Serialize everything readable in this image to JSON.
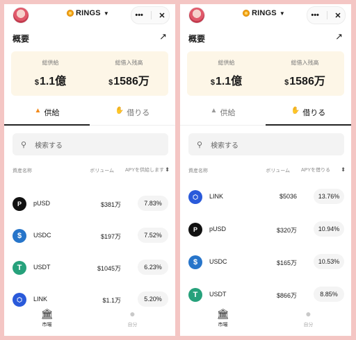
{
  "screens": [
    {
      "header": {
        "brand": "RINGS",
        "menu_icon": "•••",
        "close_icon": "✕"
      },
      "overview": {
        "title": "概要",
        "arrow": "↗"
      },
      "summary": {
        "supply_label": "総供給",
        "supply_currency": "$",
        "supply_value": "1.1億",
        "borrow_label": "総借入残高",
        "borrow_currency": "$",
        "borrow_value": "1586万"
      },
      "tabs": [
        {
          "label": "供給",
          "active": true
        },
        {
          "label": "借りる",
          "active": false
        }
      ],
      "search": {
        "placeholder": "検索する"
      },
      "columns": {
        "asset": "資産名称",
        "volume": "ボリューム",
        "apy": "APYを供給します"
      },
      "rows": [
        {
          "asset": "pUSD",
          "icon": "pusd-icon",
          "volume": "$381万",
          "apy": "7.83%"
        },
        {
          "asset": "USDC",
          "icon": "usdc-icon",
          "volume": "$197万",
          "apy": "7.52%"
        },
        {
          "asset": "USDT",
          "icon": "usdt-icon",
          "volume": "$1045万",
          "apy": "6.23%"
        },
        {
          "asset": "LINK",
          "icon": "link-icon",
          "volume": "$1.1万",
          "apy": "5.20%"
        }
      ],
      "nav": {
        "market": "市場",
        "me": "自分"
      }
    },
    {
      "header": {
        "brand": "RINGS",
        "menu_icon": "•••",
        "close_icon": "✕"
      },
      "overview": {
        "title": "概要",
        "arrow": "↗"
      },
      "summary": {
        "supply_label": "総供給",
        "supply_currency": "$",
        "supply_value": "1.1億",
        "borrow_label": "総借入残高",
        "borrow_currency": "$",
        "borrow_value": "1586万"
      },
      "tabs": [
        {
          "label": "供給",
          "active": false
        },
        {
          "label": "借りる",
          "active": true
        }
      ],
      "search": {
        "placeholder": "検索する"
      },
      "columns": {
        "asset": "資産名称",
        "volume": "ボリューム",
        "apy": "APYを借りる"
      },
      "rows": [
        {
          "asset": "LINK",
          "icon": "link-icon",
          "volume": "$5036",
          "apy": "13.76%"
        },
        {
          "asset": "pUSD",
          "icon": "pusd-icon",
          "volume": "$320万",
          "apy": "10.94%"
        },
        {
          "asset": "USDC",
          "icon": "usdc-icon",
          "volume": "$165万",
          "apy": "10.53%"
        },
        {
          "asset": "USDT",
          "icon": "usdt-icon",
          "volume": "$866万",
          "apy": "8.85%"
        }
      ],
      "nav": {
        "market": "市場",
        "me": "自分"
      }
    }
  ],
  "colors": {
    "background": "#f4c6c4",
    "summary_bg": "#fdf6e7",
    "accent": "#f28a1b"
  }
}
